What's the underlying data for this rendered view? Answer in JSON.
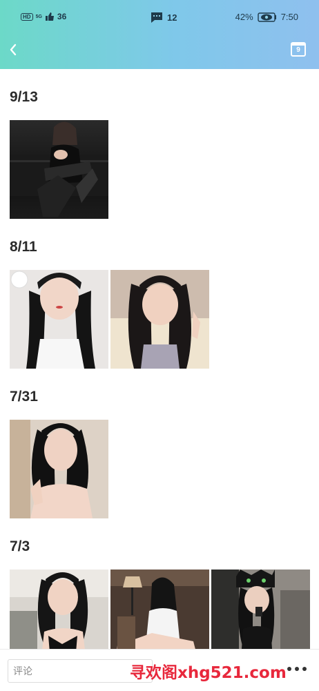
{
  "status_bar": {
    "network_left": "HD",
    "signal_text": "5G",
    "signal_text2": "36",
    "message_count": "12",
    "battery": "42%",
    "time": "7:50"
  },
  "nav": {
    "back_icon": "chevron-left-icon",
    "calendar_icon": "calendar-icon",
    "calendar_day": "9"
  },
  "sections": [
    {
      "date": "9/13",
      "photo_count": 1
    },
    {
      "date": "8/11",
      "photo_count": 2
    },
    {
      "date": "7/31",
      "photo_count": 1
    },
    {
      "date": "7/3",
      "photo_count": 3
    }
  ],
  "bottom_bar": {
    "comment_placeholder": "评论",
    "more_icon": "more-dots-icon"
  },
  "watermark": "寻欢阁xhg521.com"
}
